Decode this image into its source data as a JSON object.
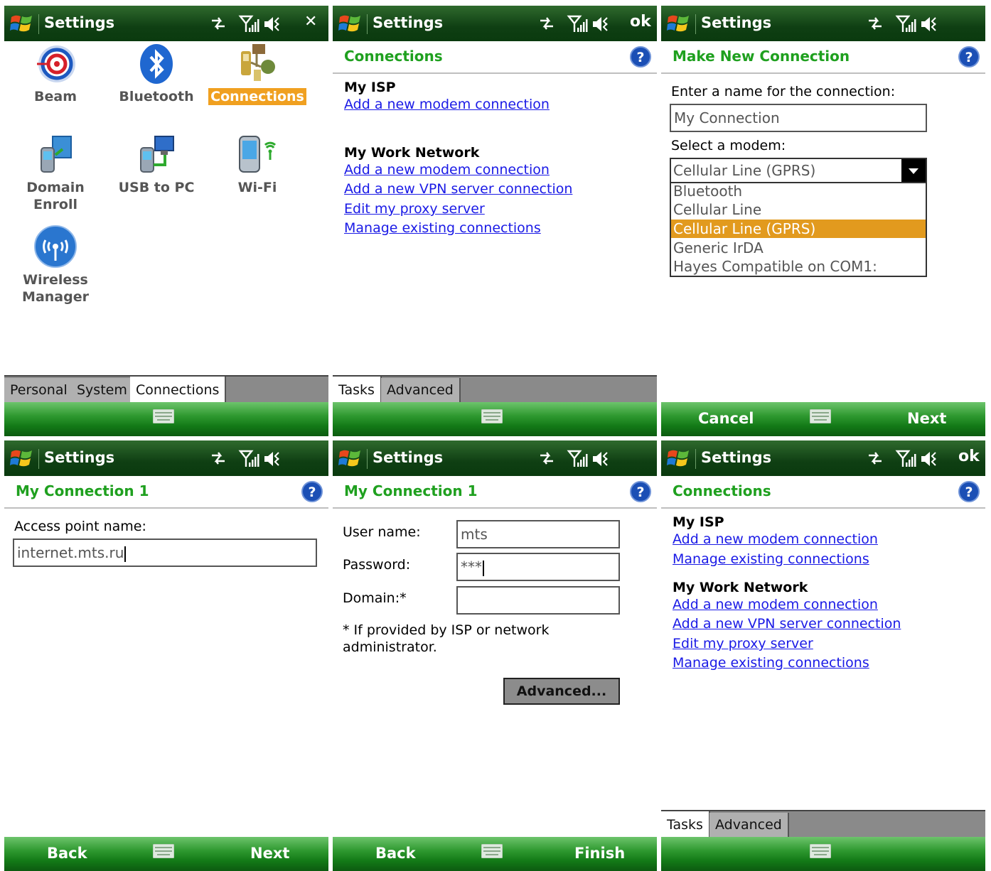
{
  "common": {
    "title": "Settings"
  },
  "panel1": {
    "close": "✕",
    "icons": [
      {
        "name": "Beam"
      },
      {
        "name": "Bluetooth"
      },
      {
        "name": "Connections"
      },
      {
        "line1": "Domain",
        "line2": "Enroll"
      },
      {
        "name": "USB to PC"
      },
      {
        "name": "Wi-Fi"
      },
      {
        "line1": "Wireless",
        "line2": "Manager"
      }
    ],
    "tabs": [
      "Personal",
      "System",
      "Connections"
    ]
  },
  "panel2": {
    "ok": "ok",
    "header": "Connections",
    "isp_title": "My ISP",
    "isp_links": [
      "Add a new modem connection"
    ],
    "work_title": "My Work Network",
    "work_links": [
      "Add a new modem connection",
      "Add a new VPN server connection",
      "Edit my proxy server",
      "Manage existing connections"
    ],
    "tabs": [
      "Tasks",
      "Advanced"
    ]
  },
  "panel3": {
    "header": "Make New Connection",
    "name_label": "Enter a name for the connection:",
    "name_value": "My Connection",
    "modem_label": "Select a modem:",
    "modem_value": "Cellular Line (GPRS)",
    "options": [
      "Bluetooth",
      "Cellular Line",
      "Cellular Line (GPRS)",
      "Generic IrDA",
      "Hayes Compatible on COM1:"
    ],
    "cancel": "Cancel",
    "next": "Next"
  },
  "panel4": {
    "header": "My Connection 1",
    "apn_label": "Access point name:",
    "apn_value": "internet.mts.ru",
    "back": "Back",
    "next": "Next"
  },
  "panel5": {
    "header": "My Connection 1",
    "user_label": "User name:",
    "user_value": "mts",
    "pass_label": "Password:",
    "pass_value": "***",
    "domain_label": "Domain:*",
    "note_line1": "* If provided by ISP or network",
    "note_line2": "administrator.",
    "advanced": "Advanced...",
    "back": "Back",
    "finish": "Finish"
  },
  "panel6": {
    "ok": "ok",
    "header": "Connections",
    "isp_title": "My ISP",
    "isp_links": [
      "Add a new modem connection",
      "Manage existing connections"
    ],
    "work_title": "My Work Network",
    "work_links": [
      "Add a new modem connection",
      "Add a new VPN server connection",
      "Edit my proxy server",
      "Manage existing connections"
    ],
    "tabs": [
      "Tasks",
      "Advanced"
    ]
  }
}
